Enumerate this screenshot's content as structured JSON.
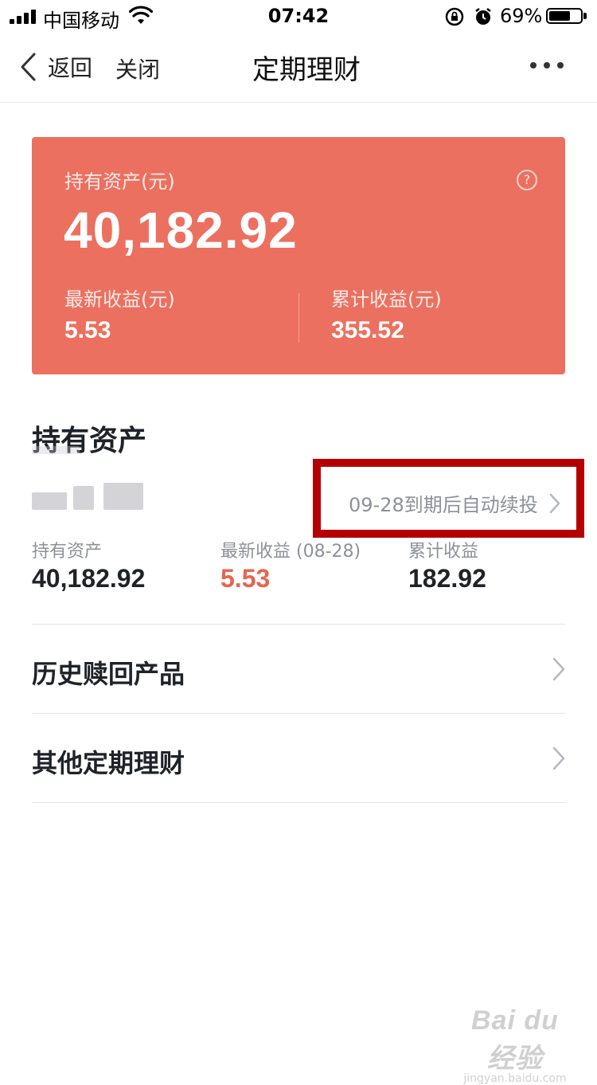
{
  "status_bar": {
    "carrier": "中国移动",
    "time": "07:42",
    "battery_percent": "69%",
    "battery_level": 0.69
  },
  "nav": {
    "back_label": "返回",
    "close_label": "关闭",
    "title": "定期理财"
  },
  "summary_card": {
    "total_label": "持有资产(元)",
    "total_value": "40,182.92",
    "latest_income_label": "最新收益(元)",
    "latest_income_value": "5.53",
    "cumulative_income_label": "累计收益(元)",
    "cumulative_income_value": "355.52",
    "background_color": "#ec705f"
  },
  "holdings": {
    "section_title": "持有资产",
    "renew_text": "09-28到期后自动续投",
    "metrics": [
      {
        "label": "持有资产",
        "value": "40,182.92"
      },
      {
        "label": "最新收益 (08-28)",
        "value": "5.53",
        "color": "#e5654f"
      },
      {
        "label": "累计收益",
        "value": "182.92"
      }
    ]
  },
  "list": [
    {
      "label": "历史赎回产品",
      "icon": "chevron-right-icon"
    },
    {
      "label": "其他定期理财",
      "icon": "chevron-right-icon"
    }
  ],
  "watermark": {
    "logo": "Bai du 经验",
    "url": "jingyan.baidu.com"
  },
  "colors": {
    "accent_red": "#e5654f",
    "highlight_box": "#b40000",
    "muted_text": "#8e9199"
  }
}
